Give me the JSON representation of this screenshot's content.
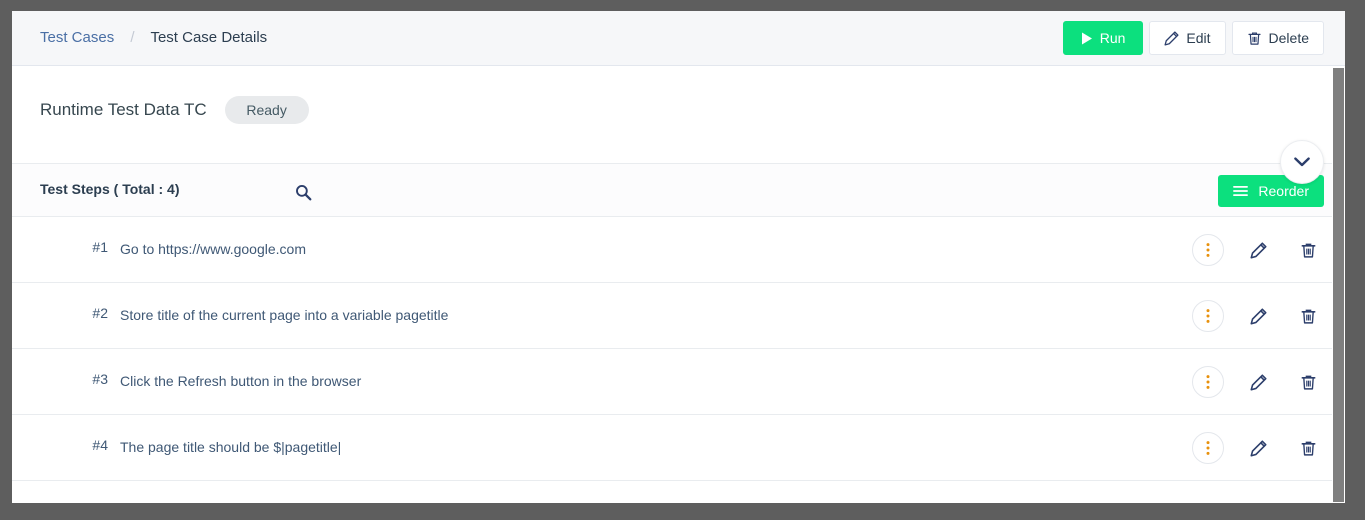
{
  "header": {
    "breadcrumb": {
      "parent": "Test Cases",
      "separator": "/",
      "current": "Test Case Details"
    },
    "actions": {
      "run_label": "Run",
      "edit_label": "Edit",
      "delete_label": "Delete"
    }
  },
  "testcase": {
    "title": "Runtime Test Data TC",
    "status": "Ready"
  },
  "steps_section": {
    "heading": "Test Steps ( Total : 4)",
    "total": 4,
    "search_icon": "search-icon",
    "reorder_label": "Reorder",
    "collapse_icon": "chevron-down-icon",
    "rows": [
      {
        "num": "#1",
        "text": "Go to https://www.google.com"
      },
      {
        "num": "#2",
        "text": "Store title of the current page into a variable pagetitle"
      },
      {
        "num": "#3",
        "text": "Click the Refresh button in the browser"
      },
      {
        "num": "#4",
        "text": "The page title should be $|pagetitle|"
      }
    ]
  },
  "colors": {
    "accent_green": "#0ce07e",
    "page_background": "#5e5e5e",
    "header_background": "#f6f7f9",
    "link_blue": "#4a6fa5",
    "step_text": "#3f5875",
    "badge_background": "#e8eaec",
    "kebab_orange": "#e8910c",
    "icon_navy": "#2c3e6b"
  }
}
